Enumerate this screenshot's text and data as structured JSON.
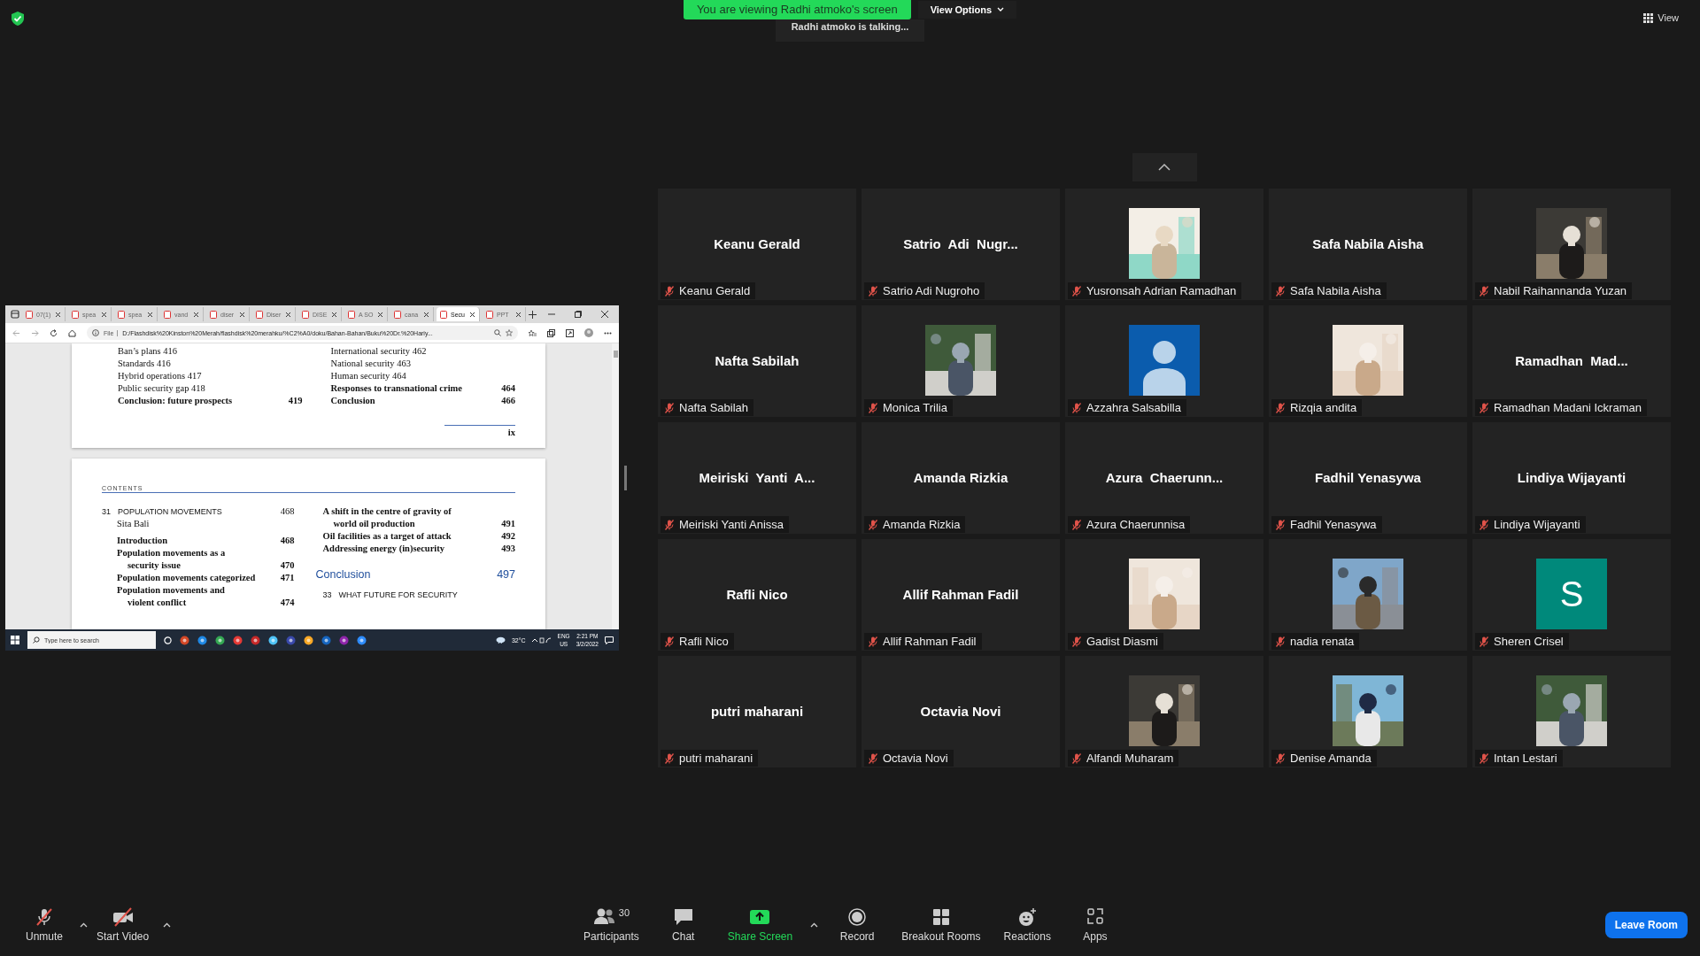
{
  "top_bar": {
    "banner": "You are viewing Radhi atmoko's screen",
    "view_options": "View Options",
    "talking": "Radhi atmoko is talking...",
    "view": "View"
  },
  "shared_screen": {
    "tabs": [
      {
        "label": "07(1)",
        "selected": false
      },
      {
        "label": "spea",
        "selected": false
      },
      {
        "label": "spea",
        "selected": false
      },
      {
        "label": "vand",
        "selected": false
      },
      {
        "label": "diser",
        "selected": false
      },
      {
        "label": "Diser",
        "selected": false
      },
      {
        "label": "DISE",
        "selected": false
      },
      {
        "label": "A SO",
        "selected": false
      },
      {
        "label": "cana",
        "selected": false
      },
      {
        "label": "Secu",
        "selected": true
      },
      {
        "label": "PPT",
        "selected": false
      }
    ],
    "address": {
      "scheme": "File",
      "url": "D:/Flashdisk%20Kinston%20Merah/flashdisk%20merahku/%C2%A0/doku/Bahan-Bahan/Buku%20Dr.%20Hariy..."
    },
    "page_1": {
      "left": [
        {
          "kind": "entry",
          "text": "Ban’s plans 416",
          "bold": false
        },
        {
          "kind": "entry",
          "text": "Standards 416",
          "bold": false
        },
        {
          "kind": "entry",
          "text": "Hybrid operations 417",
          "bold": false
        },
        {
          "kind": "entry",
          "text": "Public security gap 418",
          "bold": false
        },
        {
          "kind": "entry",
          "text": "Conclusion: future prospects",
          "page": "419",
          "bold": true
        }
      ],
      "right": [
        {
          "kind": "entry",
          "text": "International security 462",
          "bold": false
        },
        {
          "kind": "entry",
          "text": "National security 463",
          "bold": false
        },
        {
          "kind": "entry",
          "text": "Human security 464",
          "bold": false
        },
        {
          "kind": "entry",
          "text": "Responses to transnational crime",
          "page": "464",
          "bold": true
        },
        {
          "kind": "entry",
          "text": "Conclusion",
          "page": "466",
          "bold": true
        }
      ],
      "folio": "ix"
    },
    "page_2": {
      "header": "CONTENTS",
      "left": [
        {
          "kind": "chapter",
          "number": "31",
          "text": "POPULATION MOVEMENTS",
          "page": "468"
        },
        {
          "kind": "author",
          "text": "Sita Bali"
        },
        {
          "kind": "entry",
          "text": "Introduction",
          "page": "468",
          "bold": true
        },
        {
          "kind": "entry",
          "text": "Population movements as a",
          "bold": true
        },
        {
          "kind": "entry",
          "text": "security issue",
          "page": "470",
          "bold": true,
          "indent": true
        },
        {
          "kind": "entry",
          "text": "Population movements categorized",
          "page": "471",
          "bold": true
        },
        {
          "kind": "entry",
          "text": "Population movements and",
          "bold": true
        },
        {
          "kind": "entry",
          "text": "violent conflict",
          "page": "474",
          "bold": true,
          "indent": true
        }
      ],
      "right": [
        {
          "kind": "entry",
          "text": "A shift in the centre of gravity of",
          "bold": true
        },
        {
          "kind": "entry",
          "text": "world oil production",
          "page": "491",
          "bold": true,
          "indent": true
        },
        {
          "kind": "entry",
          "text": "Oil facilities as a target of attack",
          "page": "492",
          "bold": true
        },
        {
          "kind": "entry",
          "text": "Addressing energy (in)security",
          "page": "493",
          "bold": true
        },
        {
          "kind": "section",
          "text": "Conclusion",
          "page": "497"
        },
        {
          "kind": "chapter",
          "number": "33",
          "text": "WHAT FUTURE FOR SECURITY"
        }
      ]
    },
    "taskbar": {
      "search_placeholder": "Type here to search",
      "weather": "32°C",
      "lang": "ENG",
      "region": "US",
      "time": "2:21 PM",
      "date": "3/2/2022"
    }
  },
  "tiles": [
    {
      "kind": "name",
      "display": "Keanu Gerald",
      "name": "Keanu Gerald",
      "muted": true
    },
    {
      "kind": "name",
      "display": "Satrio  Adi  Nugr...",
      "name": "Satrio Adi Nugroho",
      "muted": true
    },
    {
      "kind": "picture",
      "name": "Yusronsah Adrian Ramadhan",
      "muted": true
    },
    {
      "kind": "name",
      "display": "Safa Nabila Aisha",
      "name": "Safa Nabila Aisha",
      "muted": true
    },
    {
      "kind": "picture",
      "name": "Nabil Raihannanda Yuzan",
      "muted": true
    },
    {
      "kind": "name",
      "display": "Nafta Sabilah",
      "name": "Nafta Sabilah",
      "muted": true
    },
    {
      "kind": "picture",
      "name": "Monica Trilia",
      "muted": true
    },
    {
      "kind": "avatar",
      "name": "Azzahra Salsabilla",
      "muted": true
    },
    {
      "kind": "picture",
      "name": "Rizqia andita",
      "muted": true
    },
    {
      "kind": "name",
      "display": "Ramadhan  Mad...",
      "name": "Ramadhan Madani Ickraman",
      "muted": true
    },
    {
      "kind": "name",
      "display": "Meiriski  Yanti  A...",
      "name": "Meiriski Yanti Anissa",
      "muted": true
    },
    {
      "kind": "name",
      "display": "Amanda Rizkia",
      "name": "Amanda Rizkia",
      "muted": true
    },
    {
      "kind": "name",
      "display": "Azura  Chaerunn...",
      "name": "Azura Chaerunnisa",
      "muted": true
    },
    {
      "kind": "name",
      "display": "Fadhil Yenasywa",
      "name": "Fadhil Yenasywa",
      "muted": true
    },
    {
      "kind": "name",
      "display": "Lindiya Wijayanti",
      "name": "Lindiya Wijayanti",
      "muted": true
    },
    {
      "kind": "name",
      "display": "Rafli Nico",
      "name": "Rafli Nico",
      "muted": true
    },
    {
      "kind": "name",
      "display": "Allif Rahman Fadil",
      "name": "Allif Rahman Fadil",
      "muted": true
    },
    {
      "kind": "picture",
      "name": "Gadist Diasmi",
      "muted": true
    },
    {
      "kind": "picture",
      "name": "nadia renata",
      "muted": true
    },
    {
      "kind": "letter",
      "letter": "S",
      "color": "#00897b",
      "name": "Sheren Crisel",
      "muted": true
    },
    {
      "kind": "name",
      "display": "putri maharani",
      "name": "putri maharani",
      "muted": true
    },
    {
      "kind": "name",
      "display": "Octavia Novi",
      "name": "Octavia Novi",
      "muted": true
    },
    {
      "kind": "picture",
      "name": "Alfandi Muharam",
      "muted": true
    },
    {
      "kind": "picture",
      "name": "Denise Amanda",
      "muted": true
    },
    {
      "kind": "picture",
      "name": "Intan Lestari",
      "muted": true
    }
  ],
  "toolbar": {
    "left": [
      {
        "kind": "mic",
        "label": "Unmute",
        "muted": true
      },
      {
        "kind": "video",
        "label": "Start Video",
        "muted": true
      }
    ],
    "center": [
      {
        "kind": "participants",
        "label": "Participants",
        "count": "30"
      },
      {
        "kind": "chat",
        "label": "Chat"
      },
      {
        "kind": "share",
        "label": "Share Screen"
      },
      {
        "kind": "record",
        "label": "Record"
      },
      {
        "kind": "breakout",
        "label": "Breakout Rooms"
      },
      {
        "kind": "reactions",
        "label": "Reactions"
      },
      {
        "kind": "apps",
        "label": "Apps"
      }
    ],
    "leave": "Leave Room"
  }
}
